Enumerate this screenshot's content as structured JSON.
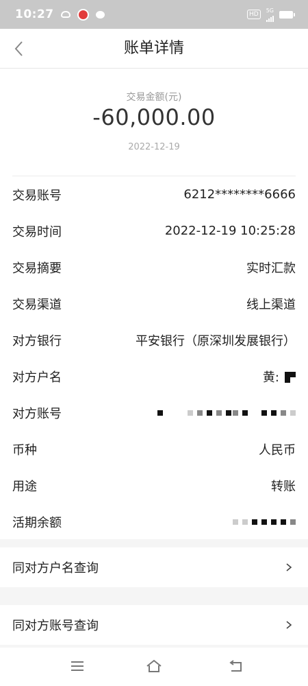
{
  "status_bar": {
    "time": "10:27",
    "network_hd": "HD",
    "network_gen": "5G"
  },
  "header": {
    "title": "账单详情"
  },
  "summary": {
    "amount_label": "交易金额(元)",
    "amount": "-60,000.00",
    "date": "2022-12-19"
  },
  "details": [
    {
      "label": "交易账号",
      "value": "6212********6666"
    },
    {
      "label": "交易时间",
      "value": "2022-12-19 10:25:28"
    },
    {
      "label": "交易摘要",
      "value": "实时汇款"
    },
    {
      "label": "交易渠道",
      "value": "线上渠道"
    },
    {
      "label": "对方银行",
      "value": "平安银行（原深圳发展银行）"
    },
    {
      "label": "对方户名",
      "value": "黄:"
    },
    {
      "label": "对方账号",
      "value": ""
    },
    {
      "label": "币种",
      "value": "人民币"
    },
    {
      "label": "用途",
      "value": "转账"
    },
    {
      "label": "活期余额",
      "value": ""
    }
  ],
  "queries": [
    {
      "label": "同对方户名查询"
    },
    {
      "label": "同对方账号查询"
    }
  ],
  "icons": {
    "back": "chevron-left-icon",
    "query_arrow": "chevron-right-icon",
    "nav_menu": "menu-icon",
    "nav_home": "home-icon",
    "nav_back": "back-icon"
  }
}
